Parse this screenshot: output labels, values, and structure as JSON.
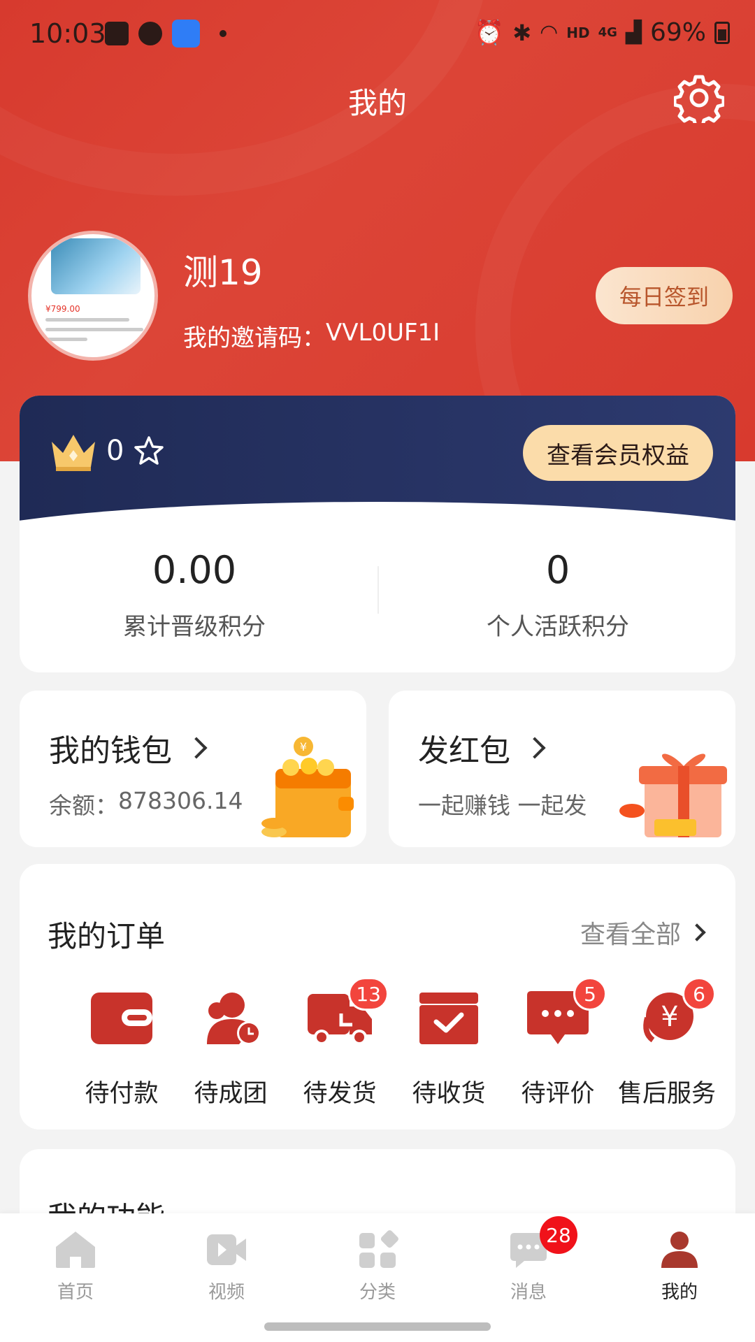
{
  "status_bar": {
    "time": "10:03",
    "network": "HD",
    "signal": "4G",
    "battery": "69%"
  },
  "header": {
    "title": "我的"
  },
  "profile": {
    "username": "测19",
    "invite_label": "我的邀请码：",
    "invite_code": "VVL0UF1I",
    "avatar_price": "¥799.00",
    "checkin_label": "每日签到"
  },
  "membership": {
    "level": "0",
    "benefits_label": "查看会员权益",
    "stats": [
      {
        "value": "0.00",
        "label": "累计晋级积分"
      },
      {
        "value": "0",
        "label": "个人活跃积分"
      }
    ]
  },
  "wallet": {
    "title": "我的钱包",
    "balance_label": "余额：",
    "balance": "878306.14"
  },
  "red_packet": {
    "title": "发红包",
    "subtitle": "一起赚钱 一起发"
  },
  "orders": {
    "title": "我的订单",
    "view_all": "查看全部",
    "items": [
      {
        "label": "待付款",
        "icon": "wallet-icon",
        "badge": ""
      },
      {
        "label": "待成团",
        "icon": "group-clock-icon",
        "badge": ""
      },
      {
        "label": "待发货",
        "icon": "truck-icon",
        "badge": "13"
      },
      {
        "label": "待收货",
        "icon": "box-check-icon",
        "badge": ""
      },
      {
        "label": "待评价",
        "icon": "chat-bubble-icon",
        "badge": "5"
      },
      {
        "label": "售后服务",
        "icon": "yuan-service-icon",
        "badge": "6"
      }
    ]
  },
  "functions": {
    "title": "我的功能"
  },
  "bottom_nav": {
    "items": [
      {
        "label": "首页",
        "icon": "home-icon"
      },
      {
        "label": "视频",
        "icon": "video-icon"
      },
      {
        "label": "分类",
        "icon": "category-icon"
      },
      {
        "label": "消息",
        "icon": "message-icon",
        "badge": "28"
      },
      {
        "label": "我的",
        "icon": "profile-icon"
      }
    ]
  },
  "colors": {
    "brand_red": "#d83d30",
    "member_navy": "#222d5b",
    "gold": "#fbdcaa",
    "badge_red": "#f2453d"
  }
}
